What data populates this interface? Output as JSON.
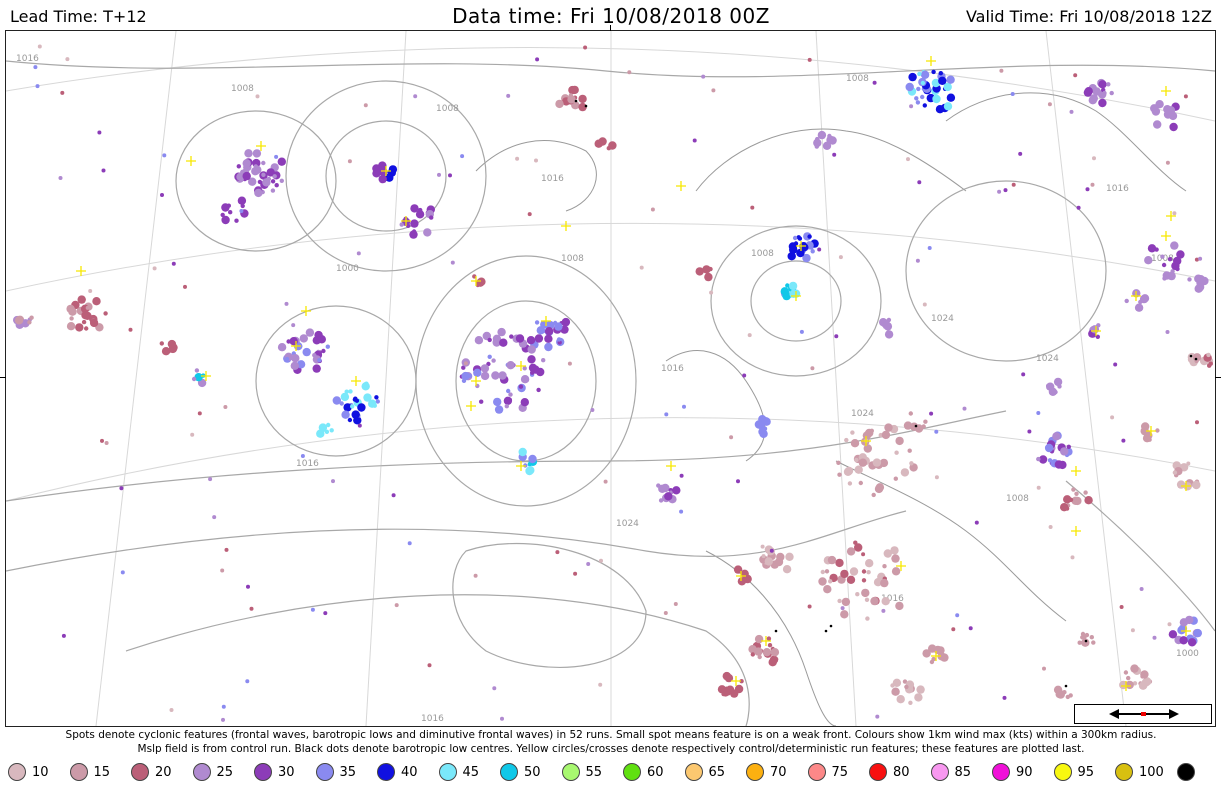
{
  "header": {
    "lead_time": "Lead Time: T+12",
    "data_time": "Data time:  Fri 10/08/2018 00Z",
    "valid_time": "Valid Time: Fri 10/08/2018 12Z"
  },
  "caption": {
    "line1": "Spots denote cyclonic features (frontal waves, barotropic lows and diminutive frontal waves) in 52 runs. Small spot means feature is on a weak front. Colours show 1km wind max (kts) within a 300km radius.",
    "line2": "Mslp field is from control run. Black dots denote barotropic low centres. Yellow circles/crosses denote respectively control/deterministic run features; these features are plotted last."
  },
  "isobar_labels": [
    "1016",
    "1008",
    "1008",
    "1000",
    "1008",
    "1016",
    "1008",
    "1016",
    "1024",
    "1024",
    "1016",
    "1008",
    "1024",
    "1016",
    "1008",
    "1024",
    "1016",
    "1000",
    "1008",
    "1016"
  ],
  "legend": [
    {
      "label": "10",
      "color": "#d8b8be"
    },
    {
      "label": "15",
      "color": "#cc9aa8"
    },
    {
      "label": "20",
      "color": "#bb5f78"
    },
    {
      "label": "25",
      "color": "#b08ad0"
    },
    {
      "label": "30",
      "color": "#8c3cb8"
    },
    {
      "label": "35",
      "color": "#8a8af0"
    },
    {
      "label": "40",
      "color": "#1010e0"
    },
    {
      "label": "45",
      "color": "#7ae8fa"
    },
    {
      "label": "50",
      "color": "#10c8e8"
    },
    {
      "label": "55",
      "color": "#a8f870"
    },
    {
      "label": "60",
      "color": "#60e010"
    },
    {
      "label": "65",
      "color": "#fcc870"
    },
    {
      "label": "70",
      "color": "#fcb010"
    },
    {
      "label": "75",
      "color": "#fc8888"
    },
    {
      "label": "80",
      "color": "#f81010"
    },
    {
      "label": "85",
      "color": "#f898f0"
    },
    {
      "label": "90",
      "color": "#f010d8"
    },
    {
      "label": "95",
      "color": "#f8f810"
    },
    {
      "label": "100",
      "color": "#d8c010"
    },
    {
      "label": "",
      "color": "#000000"
    }
  ]
}
